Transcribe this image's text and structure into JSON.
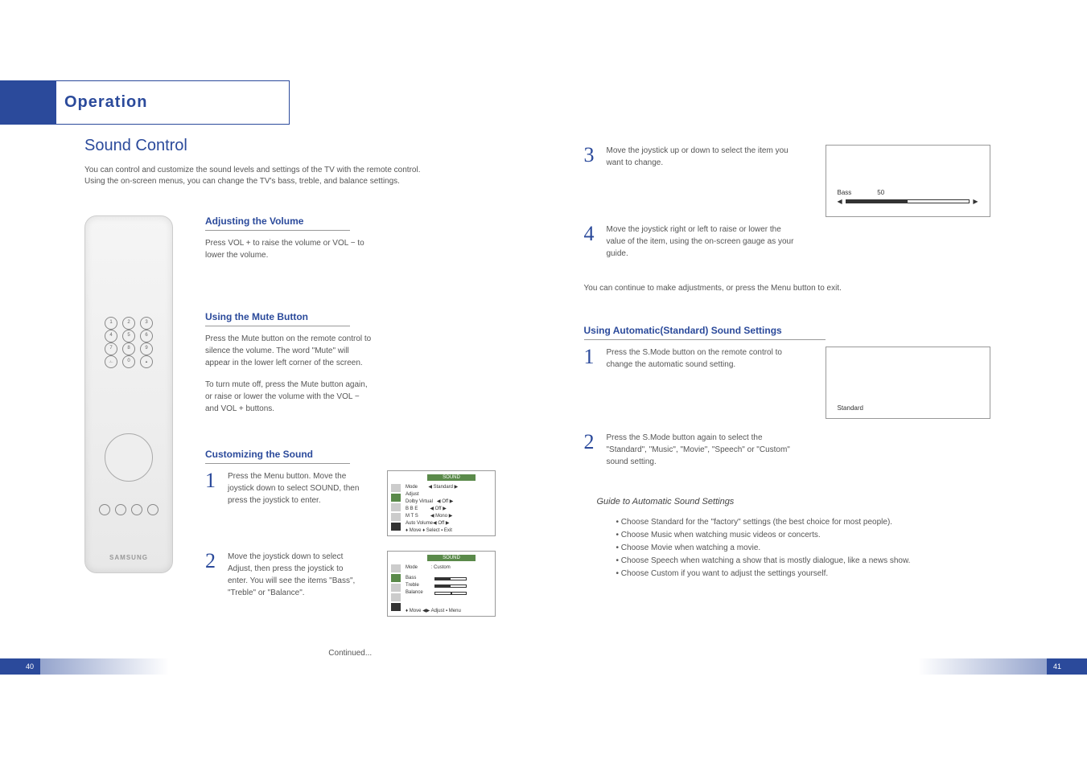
{
  "left": {
    "header": "Operation",
    "title": "Sound Control",
    "intro": "You can control and customize the sound levels and settings of the TV with the remote control. Using the on-screen menus, you can change the TV's bass, treble, and balance settings.",
    "remote_brand": "SAMSUNG",
    "sub1": {
      "h": "Adjusting the Volume",
      "t": "Press VOL + to raise the volume or VOL − to lower the volume."
    },
    "sub2": {
      "h": "Using the Mute Button",
      "t1": "Press the Mute button on the remote control to silence the volume. The word \"Mute\" will appear in the lower left corner of the screen.",
      "t2": "To turn mute off, press the Mute button again, or raise or lower the volume with the VOL − and VOL + buttons."
    },
    "sub3": {
      "h": "Customizing the Sound",
      "step1_n": "1",
      "step1_t": "Press the Menu button. Move the joystick down to select SOUND, then press the joystick to enter.",
      "step2_n": "2",
      "step2_t": "Move the joystick down to select Adjust, then press the joystick to enter. You will see the items \"Bass\", \"Treble\" or \"Balance\"."
    },
    "tv1": {
      "title": "SOUND",
      "l1": "Mode",
      "v1": "◀ Standard ▶",
      "l2": "Adjust",
      "l3": "Dolby Virtual",
      "v3": "◀ Off ▶",
      "l4": "B B E",
      "v4": "◀   Off  ▶",
      "l5": "M T S",
      "v5": "◀  Mono ▶",
      "l6": "Auto Volume",
      "v6": "◀   Off   ▶",
      "foot": "♦ Move  ♦ Select  ▪ Exit"
    },
    "tv2": {
      "title": "SOUND",
      "l1": "Mode",
      "v1": ": Custom",
      "l2": "Bass",
      "l3": "Treble",
      "l4": "Balance",
      "foot": "♦ Move  ◀▶ Adjust  ▪ Menu"
    },
    "continued": "Continued...",
    "page_num": "40"
  },
  "right": {
    "step3_n": "3",
    "step3_t": "Move the joystick up or down to select the item you want to change.",
    "step4_n": "4",
    "step4_t": "Move the joystick right or left to raise or lower the value of the item, using the on-screen gauge as your guide.",
    "gauge": {
      "label": "Bass",
      "value": "50"
    },
    "note": "You can continue to make adjustments, or press the Menu button to exit.",
    "sub4": {
      "h": "Using Automatic(Standard) Sound Settings",
      "step1_n": "1",
      "step1_t": "Press the S.Mode button on the remote control to change the automatic sound setting.",
      "step2_n": "2",
      "step2_t": "Press the S.Mode button again to select the \"Standard\", \"Music\", \"Movie\", \"Speech\" or \"Custom\" sound setting."
    },
    "mode_label": "Standard",
    "guide_h": "Guide to Automatic Sound Settings",
    "bullets": {
      "b1": "Choose Standard for the \"factory\" settings (the best choice for most people).",
      "b2": "Choose Music when watching music videos or concerts.",
      "b3": "Choose Movie when watching a movie.",
      "b4": "Choose Speech when watching a show that is mostly dialogue, like a news show.",
      "b5": "Choose Custom if you want to adjust the settings yourself."
    },
    "page_num": "41"
  }
}
